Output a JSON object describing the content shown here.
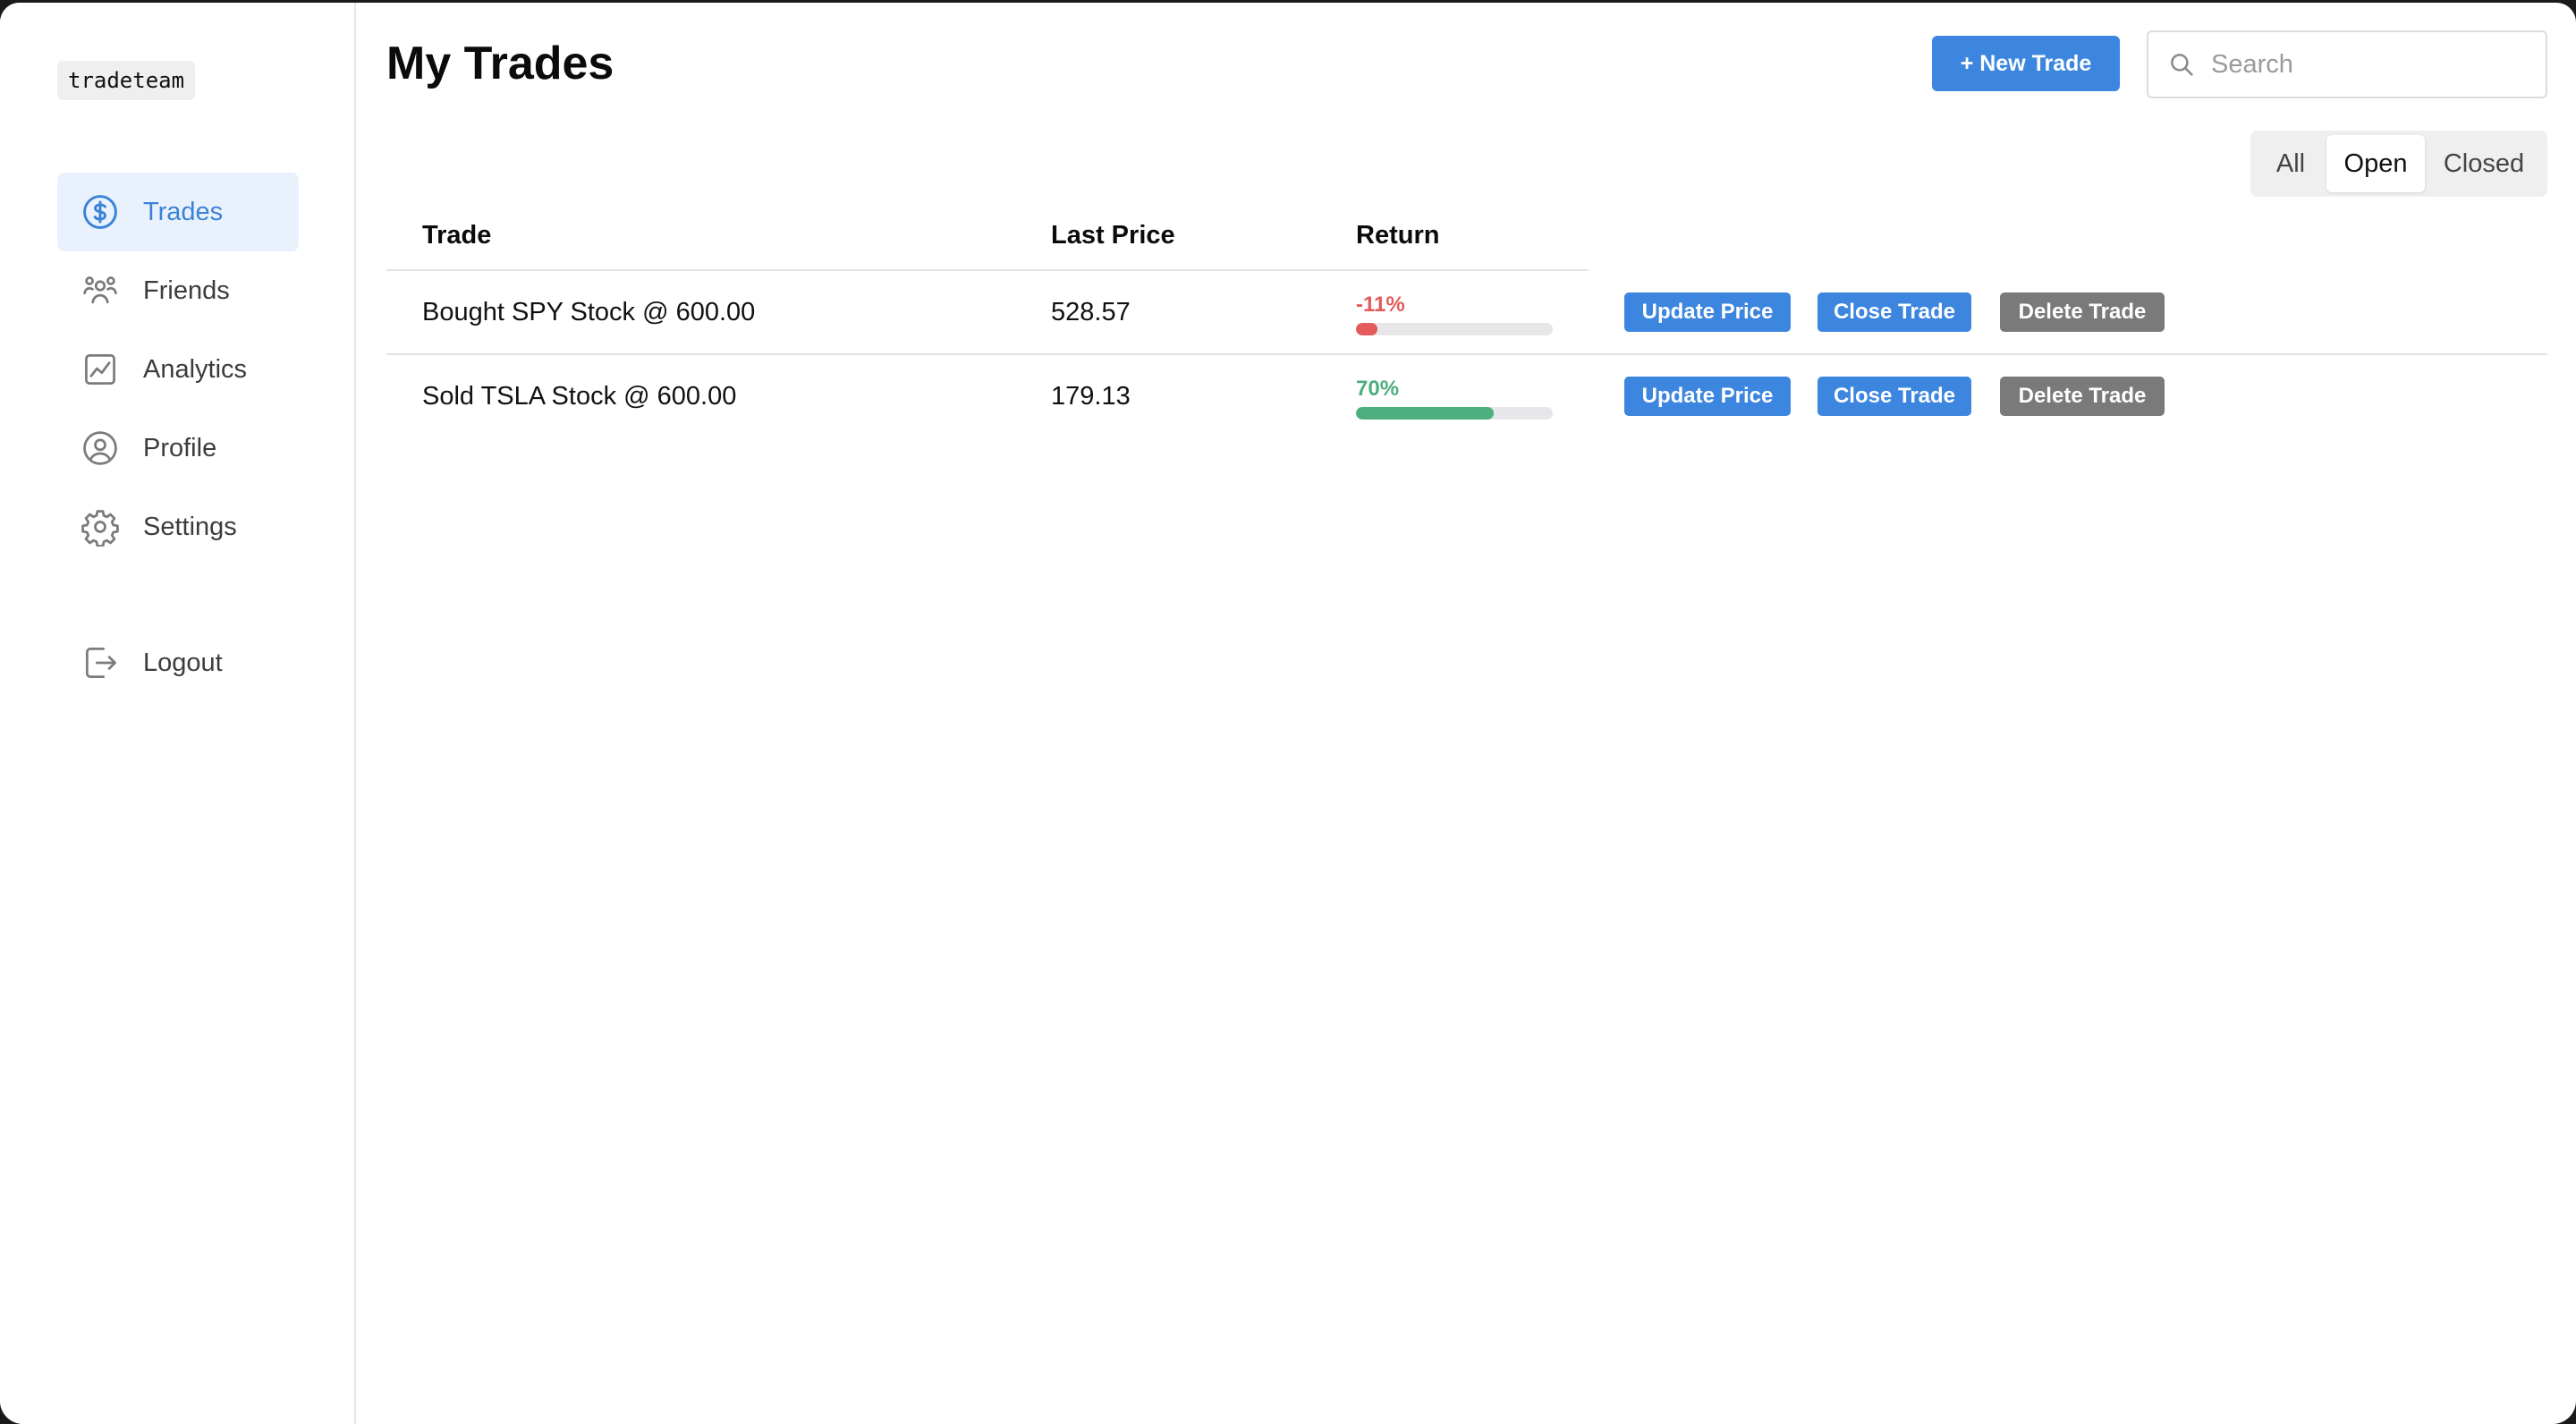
{
  "brand": "tradeteam",
  "sidebar": {
    "items": [
      {
        "label": "Trades",
        "icon": "dollar-circle-icon",
        "active": true
      },
      {
        "label": "Friends",
        "icon": "users-icon",
        "active": false
      },
      {
        "label": "Analytics",
        "icon": "chart-icon",
        "active": false
      },
      {
        "label": "Profile",
        "icon": "user-circle-icon",
        "active": false
      },
      {
        "label": "Settings",
        "icon": "gear-icon",
        "active": false
      },
      {
        "label": "Logout",
        "icon": "logout-icon",
        "active": false
      }
    ]
  },
  "header": {
    "title": "My Trades",
    "new_trade_label": "+ New Trade",
    "search_placeholder": "Search",
    "search_value": ""
  },
  "filters": {
    "options": [
      "All",
      "Open",
      "Closed"
    ],
    "selected": "Open"
  },
  "table": {
    "columns": [
      "Trade",
      "Last Price",
      "Return"
    ],
    "rows": [
      {
        "trade": "Bought SPY Stock @ 600.00",
        "last_price": "528.57",
        "return_label": "-11%",
        "return_fraction": 0.11,
        "return_color": "#e35b5b",
        "actions": [
          "Update Price",
          "Close Trade",
          "Delete Trade"
        ]
      },
      {
        "trade": "Sold TSLA Stock @ 600.00",
        "last_price": "179.13",
        "return_label": "70%",
        "return_fraction": 0.7,
        "return_color": "#4caf7d",
        "actions": [
          "Update Price",
          "Close Trade",
          "Delete Trade"
        ]
      }
    ]
  },
  "colors": {
    "accent": "#3d86df",
    "active_bg": "#e9f2fc",
    "delete": "#7a7a7a",
    "negative": "#e35b5b",
    "positive": "#4caf7d"
  }
}
